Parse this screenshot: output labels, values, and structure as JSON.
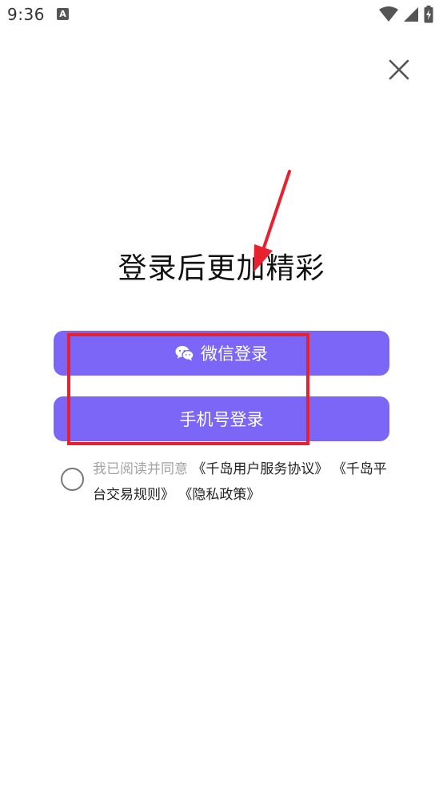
{
  "status_bar": {
    "time": "9:36",
    "app_icon_letter": "A"
  },
  "title": "登录后更加精彩",
  "buttons": {
    "wechat_label": "微信登录",
    "phone_label": "手机号登录"
  },
  "agreement": {
    "prefix": "我已阅读并同意",
    "links": [
      "《千岛用户服务协议》",
      "《千岛平台交易规则》",
      "《隐私政策》"
    ]
  },
  "colors": {
    "button": "#7b66f7",
    "annotation": "#e8212f"
  }
}
